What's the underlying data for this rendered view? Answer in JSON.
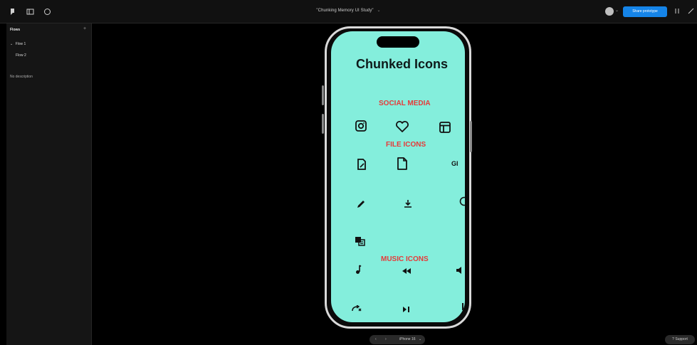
{
  "toolbar": {
    "title": "\"Chunking Memory UI Study\"",
    "title_caret": "⌄",
    "share_label": "Share prototype",
    "avatar_caret": "⌄",
    "icons": [
      "logo-icon",
      "sidebar-toggle-icon",
      "comment-icon",
      "restart-icon",
      "expand-icon"
    ]
  },
  "left_panel": {
    "heading": "Flows",
    "add": "+",
    "flows": [
      {
        "label": "Flow 1",
        "expanded_marker": "⌄"
      },
      {
        "label": "Flow 2"
      }
    ],
    "description": "No description"
  },
  "phone": {
    "app_title": "Chunked Icons",
    "sections": [
      "SOCIAL MEDIA",
      "FILE ICONS",
      "MUSIC ICONS"
    ],
    "gif_label": "GI",
    "icons": {
      "social": [
        "instagram-icon",
        "heart-icon",
        "layout-icon"
      ],
      "file": [
        "file-edit-icon",
        "file-icon",
        "gif-icon",
        "pencil-icon",
        "download-icon",
        "clock-icon",
        "translate-icon"
      ],
      "music": [
        "music-note-icon",
        "rewind-icon",
        "volume-icon",
        "repeat-icon",
        "play-pause-icon"
      ]
    }
  },
  "bottom": {
    "prev": "‹",
    "next": "›",
    "device": "iPhone 16",
    "device_caret": "⌄",
    "support": "? Support"
  },
  "colors": {
    "screen_bg": "#84eedc",
    "section_red": "#e63a39",
    "share_blue": "#1584e8"
  }
}
